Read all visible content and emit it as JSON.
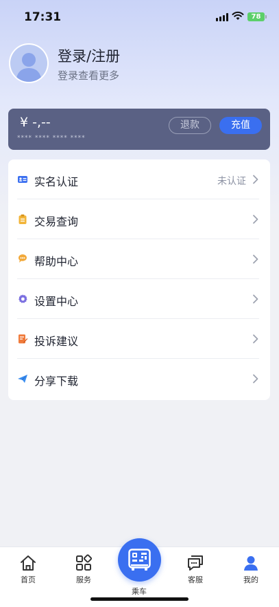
{
  "status_bar": {
    "time": "17:31",
    "battery": "78"
  },
  "profile": {
    "title": "登录/注册",
    "subtitle": "登录查看更多"
  },
  "balance": {
    "amount": "¥ -,--",
    "card_number": "**** **** **** ****",
    "refund_label": "退款",
    "recharge_label": "充值"
  },
  "menu": {
    "items": [
      {
        "label": "实名认证",
        "status": "未认证",
        "icon": "id-card-icon"
      },
      {
        "label": "交易查询",
        "status": "",
        "icon": "clipboard-icon"
      },
      {
        "label": "帮助中心",
        "status": "",
        "icon": "chat-bubble-icon"
      },
      {
        "label": "设置中心",
        "status": "",
        "icon": "gear-icon"
      },
      {
        "label": "投诉建议",
        "status": "",
        "icon": "edit-note-icon"
      },
      {
        "label": "分享下载",
        "status": "",
        "icon": "paper-plane-icon"
      }
    ]
  },
  "bottom_nav": {
    "home": "首页",
    "services": "服务",
    "ride": "乘车",
    "support": "客服",
    "mine": "我的"
  },
  "colors": {
    "accent": "#3a6ff0",
    "card": "#5a6184",
    "background": "#f0f1f5"
  }
}
